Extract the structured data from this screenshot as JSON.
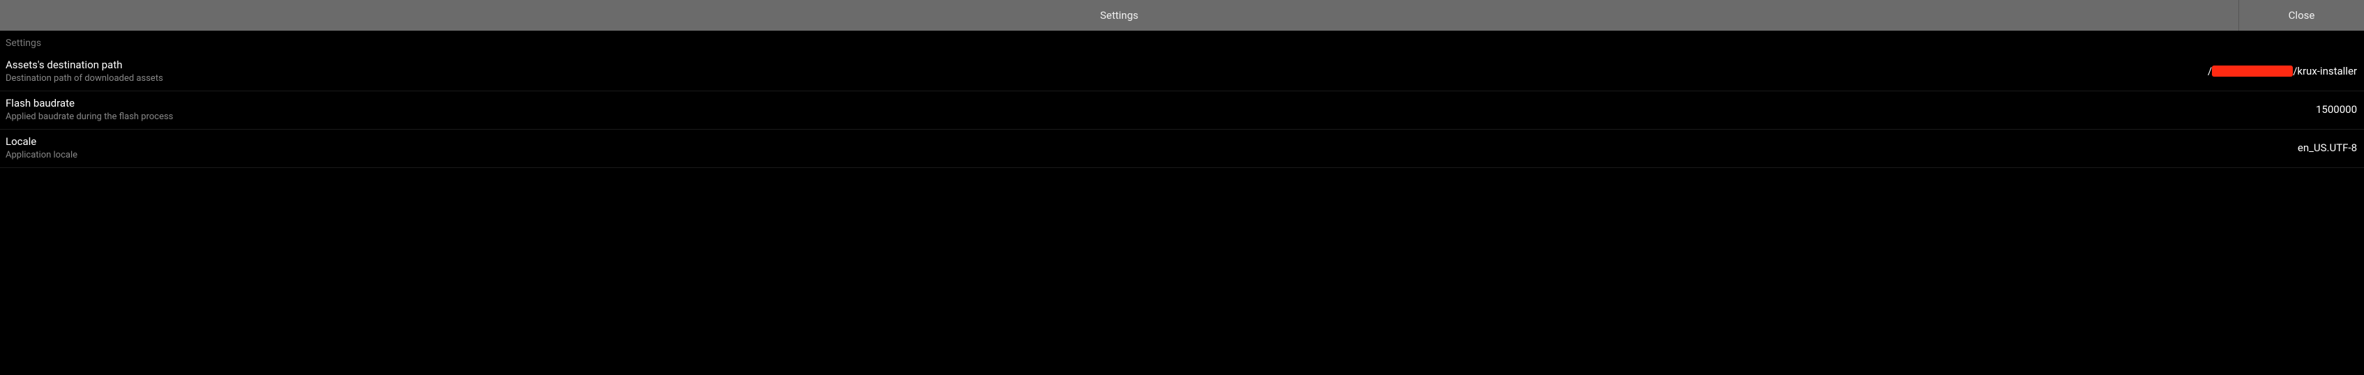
{
  "header": {
    "title": "Settings",
    "close_label": "Close"
  },
  "section_label": "Settings",
  "settings": {
    "path": {
      "title": "Assets's destination path",
      "desc": "Destination path of downloaded assets",
      "value_prefix": "/",
      "value_suffix": "/krux-installer"
    },
    "baudrate": {
      "title": "Flash baudrate",
      "desc": "Applied baudrate during the flash process",
      "value": "1500000"
    },
    "locale": {
      "title": "Locale",
      "desc": "Application locale",
      "value": "en_US.UTF-8"
    }
  }
}
